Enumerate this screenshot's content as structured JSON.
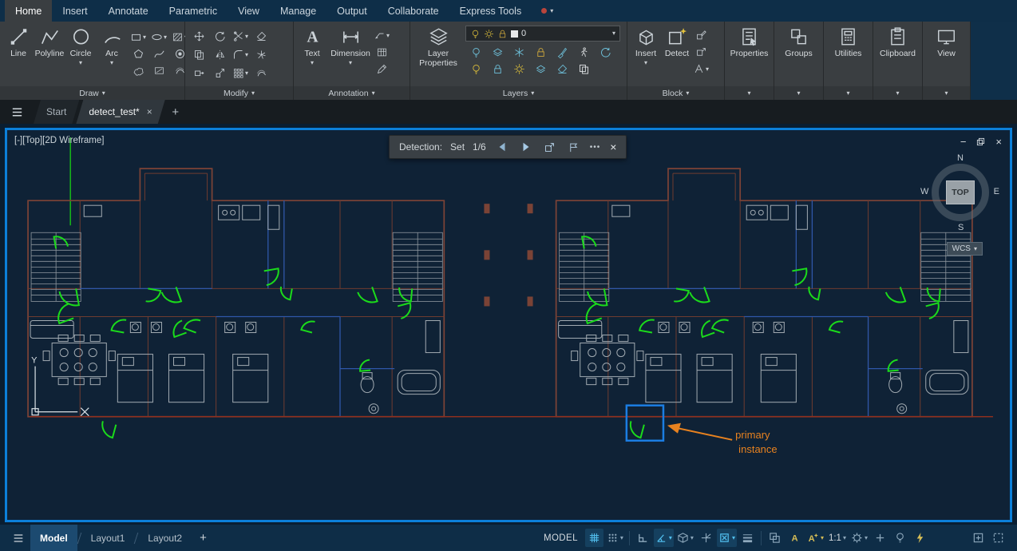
{
  "icons": {
    "caret": "▾",
    "close": "×",
    "minimize": "−",
    "ellipsis": "•••",
    "plus": "+"
  },
  "ribbon_tabs": {
    "items": [
      {
        "label": "Home",
        "active": true
      },
      {
        "label": "Insert"
      },
      {
        "label": "Annotate"
      },
      {
        "label": "Parametric"
      },
      {
        "label": "View"
      },
      {
        "label": "Manage"
      },
      {
        "label": "Output"
      },
      {
        "label": "Collaborate"
      },
      {
        "label": "Express Tools"
      }
    ]
  },
  "ribbon": {
    "draw": {
      "label": "Draw",
      "line": "Line",
      "polyline": "Polyline",
      "circle": "Circle",
      "arc": "Arc"
    },
    "modify": {
      "label": "Modify"
    },
    "annotation": {
      "label": "Annotation",
      "text": "Text",
      "dimension": "Dimension"
    },
    "layers": {
      "label": "Layers",
      "layer_properties": "Layer Properties",
      "current_layer": "0"
    },
    "block": {
      "label": "Block",
      "insert": "Insert",
      "detect": "Detect"
    },
    "properties_label": "Properties",
    "groups_label": "Groups",
    "utilities_label": "Utilities",
    "clipboard_label": "Clipboard",
    "view_label": "View"
  },
  "file_tabs": {
    "start": "Start",
    "document": "detect_test*"
  },
  "viewport": {
    "label": "[-][Top][2D Wireframe]",
    "viewcube": {
      "n": "N",
      "e": "E",
      "s": "S",
      "w": "W",
      "top": "TOP"
    },
    "wcs": "WCS"
  },
  "detection": {
    "label": "Detection:",
    "set_label": "Set",
    "counter": "1/6"
  },
  "callout": {
    "line1": "primary",
    "line2": "instance"
  },
  "layout_tabs": {
    "model": "Model",
    "layout1": "Layout1",
    "layout2": "Layout2"
  },
  "status": {
    "model_label": "MODEL",
    "scale": "1:1"
  },
  "colors": {
    "viewport_border": "#0c80da",
    "door_green": "#1bdb1b",
    "callout_orange": "#e8821f",
    "wall_red": "#7d4336",
    "highlight_blue": "#1b7de2",
    "canvas": "#0f2236"
  }
}
